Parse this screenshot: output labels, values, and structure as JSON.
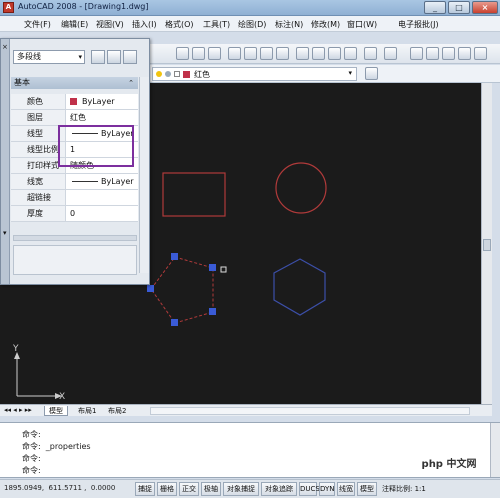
{
  "window": {
    "title": "AutoCAD 2008 - [Drawing1.dwg]",
    "controls": [
      "_",
      "□",
      "×"
    ]
  },
  "menu": [
    "文件(F)",
    "编辑(E)",
    "视图(V)",
    "插入(I)",
    "格式(O)",
    "工具(T)",
    "绘图(D)",
    "标注(N)",
    "修改(M)",
    "窗口(W)",
    "电子报批(J)"
  ],
  "layerbar": {
    "current_layer": "红色"
  },
  "properties": {
    "object_type": "多段线",
    "section": "基本",
    "rows": [
      {
        "label": "颜色",
        "value": "ByLayer",
        "swatch": "#c0314a"
      },
      {
        "label": "图层",
        "value": "红色"
      },
      {
        "label": "线型",
        "value": "ByLayer"
      },
      {
        "label": "线型比例",
        "value": "1"
      },
      {
        "label": "打印样式",
        "value": "随颜色"
      },
      {
        "label": "线宽",
        "value": "ByLayer"
      },
      {
        "label": "超链接",
        "value": ""
      },
      {
        "label": "厚度",
        "value": "0"
      }
    ]
  },
  "canvas": {
    "ucs_x": "X",
    "ucs_y": "Y",
    "colors": {
      "red": "#b03a3a",
      "blue": "#3c4fa8",
      "grip": "#3a5bd6"
    }
  },
  "tabs": [
    "模型",
    "布局1",
    "布局2"
  ],
  "command": {
    "lines": [
      "命令:",
      "命令:  _properties",
      "命令:",
      "命令:"
    ]
  },
  "status": {
    "coords": "1895.0949,  611.5711 ,  0.0000",
    "buttons": [
      "捕捉",
      "栅格",
      "正交",
      "极轴",
      "对象捕捉",
      "对象追踪",
      "DUCS",
      "DYN",
      "线宽",
      "模型"
    ],
    "extra": "注释比例: 1:1"
  },
  "watermark": "php 中文网"
}
